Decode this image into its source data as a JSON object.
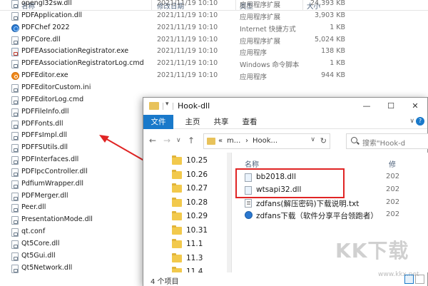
{
  "background_explorer": {
    "columns": {
      "name": "名称",
      "date": "修改日期",
      "type": "类型",
      "size": "大小"
    },
    "rows": [
      {
        "name": "opengl32sw.dll",
        "date": "2021/11/19 10:10",
        "type": "应用程序扩展",
        "size": "24,393 KB",
        "icon": "dll-file-icon"
      },
      {
        "name": "PDFApplication.dll",
        "date": "2021/11/19 10:10",
        "type": "应用程序扩展",
        "size": "3,903 KB",
        "icon": "dll-file-icon"
      },
      {
        "name": "PDFChef 2022",
        "date": "2021/11/19 10:10",
        "type": "Internet 快捷方式",
        "size": "1 KB",
        "icon": "internet-shortcut-icon"
      },
      {
        "name": "PDFCore.dll",
        "date": "2021/11/19 10:10",
        "type": "应用程序扩展",
        "size": "5,024 KB",
        "icon": "dll-file-icon"
      },
      {
        "name": "PDFEAssociationRegistrator.exe",
        "date": "2021/11/19 10:10",
        "type": "应用程序",
        "size": "138 KB",
        "icon": "exe-file-icon"
      },
      {
        "name": "PDFEAssociationRegistratorLog.cmd",
        "date": "2021/11/19 10:10",
        "type": "Windows 命令脚本",
        "size": "1 KB",
        "icon": "cmd-file-icon"
      },
      {
        "name": "PDFEditor.exe",
        "date": "2021/11/19 10:10",
        "type": "应用程序",
        "size": "944 KB",
        "icon": "pdfeditor-app-icon"
      },
      {
        "name": "PDFEditorCustom.ini",
        "date": "",
        "type": "",
        "size": "",
        "icon": "ini-file-icon"
      },
      {
        "name": "PDFEditorLog.cmd",
        "date": "",
        "type": "",
        "size": "",
        "icon": "cmd-file-icon"
      },
      {
        "name": "PDFFileInfo.dll",
        "date": "",
        "type": "",
        "size": "",
        "icon": "dll-file-icon"
      },
      {
        "name": "PDFFonts.dll",
        "date": "",
        "type": "",
        "size": "",
        "icon": "dll-file-icon"
      },
      {
        "name": "PDFFsImpl.dll",
        "date": "",
        "type": "",
        "size": "",
        "icon": "dll-file-icon"
      },
      {
        "name": "PDFFSUtils.dll",
        "date": "",
        "type": "",
        "size": "",
        "icon": "dll-file-icon"
      },
      {
        "name": "PDFInterfaces.dll",
        "date": "",
        "type": "",
        "size": "",
        "icon": "dll-file-icon"
      },
      {
        "name": "PDFIpcController.dll",
        "date": "",
        "type": "",
        "size": "",
        "icon": "dll-file-icon"
      },
      {
        "name": "PdfiumWrapper.dll",
        "date": "",
        "type": "",
        "size": "",
        "icon": "dll-file-icon"
      },
      {
        "name": "PDFMerger.dll",
        "date": "",
        "type": "",
        "size": "",
        "icon": "dll-file-icon"
      },
      {
        "name": "Peer.dll",
        "date": "",
        "type": "",
        "size": "",
        "icon": "dll-file-icon"
      },
      {
        "name": "PresentationMode.dll",
        "date": "",
        "type": "",
        "size": "",
        "icon": "dll-file-icon"
      },
      {
        "name": "qt.conf",
        "date": "",
        "type": "",
        "size": "",
        "icon": "conf-file-icon"
      },
      {
        "name": "Qt5Core.dll",
        "date": "",
        "type": "",
        "size": "",
        "icon": "dll-file-icon"
      },
      {
        "name": "Qt5Gui.dll",
        "date": "",
        "type": "",
        "size": "",
        "icon": "dll-file-icon"
      },
      {
        "name": "Qt5Network.dll",
        "date": "",
        "type": "",
        "size": "",
        "icon": "dll-file-icon"
      }
    ]
  },
  "window": {
    "title": "Hook-dll",
    "tabs": [
      "文件",
      "主页",
      "共享",
      "查看"
    ],
    "active_tab": "文件",
    "address": {
      "prefix": "«",
      "segment1": "m...",
      "separator": "›",
      "segment2": "Hook...",
      "dropdown": "∨",
      "refresh": "↻"
    },
    "search_placeholder": "搜索\"Hook-d",
    "nav_folders": [
      "10.25",
      "10.26",
      "10.27",
      "10.28",
      "10.29",
      "10.31",
      "11.1",
      "11.3",
      "11.4"
    ],
    "content_columns": {
      "name": "名称",
      "date_partial": "修"
    },
    "files": [
      {
        "name": "bb2018.dll",
        "date": "202",
        "icon": "dll-file-icon"
      },
      {
        "name": "wtsapi32.dll",
        "date": "202",
        "icon": "dll-file-icon"
      },
      {
        "name": "zdfans(解压密码)下载说明.txt",
        "date": "202",
        "icon": "txt-file-icon"
      },
      {
        "name": "zdfans下载（软件分享平台领跑者）",
        "date": "202",
        "icon": "internet-shortcut-icon"
      }
    ],
    "status": "4 个项目"
  },
  "watermark": {
    "logo_text": "KK下载",
    "url_text": "www.kkx.net"
  },
  "colors": {
    "accent": "#1979ca",
    "highlight_box": "#e02424",
    "arrow": "#e02424",
    "folder": "#f2c94c"
  }
}
